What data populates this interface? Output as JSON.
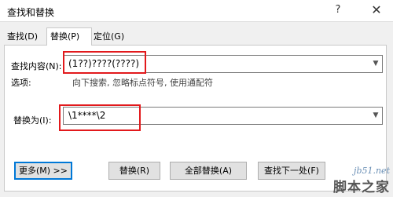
{
  "window": {
    "title": "查找和替换",
    "help_label": "?",
    "close_label": "✕"
  },
  "tabs": [
    {
      "label": "查找(D)"
    },
    {
      "label": "替换(P)"
    },
    {
      "label": "定位(G)"
    }
  ],
  "find": {
    "label": "查找内容(N):",
    "value": "(1??)????(????)"
  },
  "options": {
    "label": "选项:",
    "value": "向下搜索, 忽略标点符号, 使用通配符"
  },
  "replace": {
    "label": "替换为(I):",
    "value": "\\1****\\2"
  },
  "buttons": {
    "more": "更多(M) >>",
    "replace": "替换(R)",
    "replace_all": "全部替换(A)",
    "find_next": "查找下一处(F)"
  },
  "watermark": {
    "url": "jb51.net",
    "brand": "脚本之家"
  },
  "colors": {
    "highlight": "#e2191c",
    "focus": "#0078d7"
  },
  "icons": {
    "dropdown": "chevron-down-icon"
  }
}
